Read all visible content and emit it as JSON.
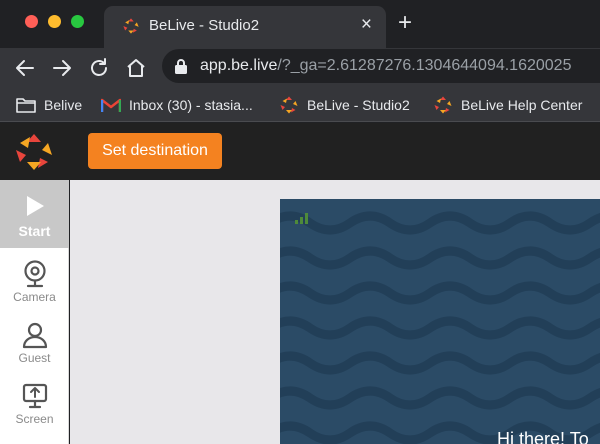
{
  "browser": {
    "tab_title": "BeLive - Studio2",
    "tab_close": "×",
    "new_tab": "+",
    "url_host": "app.be.live",
    "url_rest": "/?_ga=2.61287276.1304644094.1620025"
  },
  "bookmarks": [
    {
      "label": "Belive",
      "icon": "folder-icon"
    },
    {
      "label": "Inbox (30) - stasia...",
      "icon": "gmail-icon"
    },
    {
      "label": "BeLive - Studio2",
      "icon": "belive-logo-icon"
    },
    {
      "label": "BeLive Help Center",
      "icon": "belive-logo-icon"
    }
  ],
  "app": {
    "cta_label": "Set destination",
    "sidebar": [
      {
        "label": "Start",
        "icon": "play-icon",
        "active": true
      },
      {
        "label": "Camera",
        "icon": "webcam-icon"
      },
      {
        "label": "Guest",
        "icon": "person-icon"
      },
      {
        "label": "Screen",
        "icon": "screen-share-icon"
      }
    ],
    "stage_greeting": "Hi there! To",
    "colors": {
      "accent": "#f48220",
      "header": "#212121",
      "stage": "#2b4b66",
      "wave": "#223f58"
    }
  }
}
